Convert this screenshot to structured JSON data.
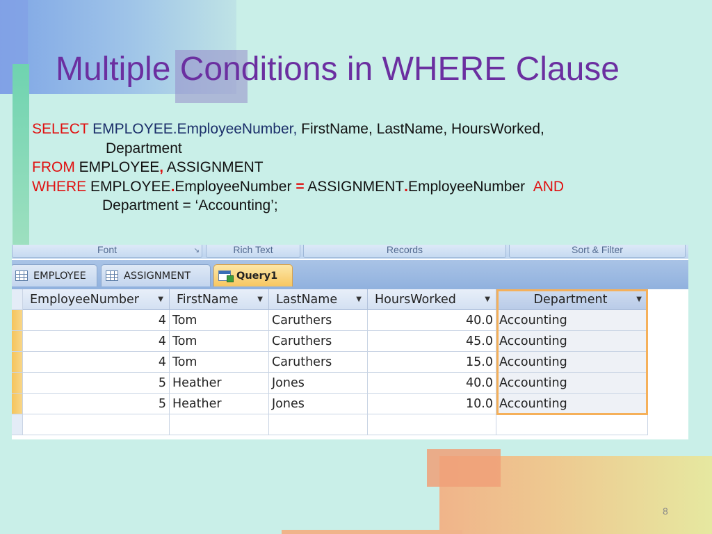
{
  "slide": {
    "title": "Multiple Conditions in WHERE Clause",
    "number": "8"
  },
  "sql": {
    "line1": {
      "kw": "SELECT",
      "name": "EMPLOYEE.EmployeeNumber,",
      "rest": "FirstName, LastName, HoursWorked,"
    },
    "line2": {
      "text": "Department"
    },
    "line3": {
      "kw": "FROM",
      "name": "EMPLOYEE",
      "comma": ",",
      "rest": "ASSIGNMENT"
    },
    "line4": {
      "kw": "WHERE",
      "name_a": "EMPLOYEE",
      "dot_a": ".",
      "field_a": "EmployeeNumber",
      "op": "=",
      "name_b": "ASSIGNMENT",
      "dot_b": ".",
      "field_b": "EmployeeNumber",
      "and": "AND"
    },
    "line5": {
      "text": "Department = ‘Accounting’;"
    }
  },
  "ribbon": {
    "groups": [
      "Font",
      "Rich Text",
      "Records",
      "Sort & Filter"
    ]
  },
  "tabs": [
    {
      "label": "EMPLOYEE",
      "icon": "table-icon",
      "active": false
    },
    {
      "label": "ASSIGNMENT",
      "icon": "table-icon",
      "active": false
    },
    {
      "label": "Query1",
      "icon": "query-icon",
      "active": true
    }
  ],
  "grid": {
    "columns": [
      "EmployeeNumber",
      "FirstName",
      "LastName",
      "HoursWorked",
      "Department"
    ],
    "rows": [
      {
        "employee_number": "4",
        "first_name": "Tom",
        "last_name": "Caruthers",
        "hours_worked": "40.0",
        "department": "Accounting"
      },
      {
        "employee_number": "4",
        "first_name": "Tom",
        "last_name": "Caruthers",
        "hours_worked": "45.0",
        "department": "Accounting"
      },
      {
        "employee_number": "4",
        "first_name": "Tom",
        "last_name": "Caruthers",
        "hours_worked": "15.0",
        "department": "Accounting"
      },
      {
        "employee_number": "5",
        "first_name": "Heather",
        "last_name": "Jones",
        "hours_worked": "40.0",
        "department": "Accounting"
      },
      {
        "employee_number": "5",
        "first_name": "Heather",
        "last_name": "Jones",
        "hours_worked": "10.0",
        "department": "Accounting"
      }
    ]
  },
  "colors": {
    "title": "#6b2fa0",
    "keyword": "#e01010",
    "highlight_outline": "#f5b05a",
    "active_tab": "#f7c660"
  }
}
